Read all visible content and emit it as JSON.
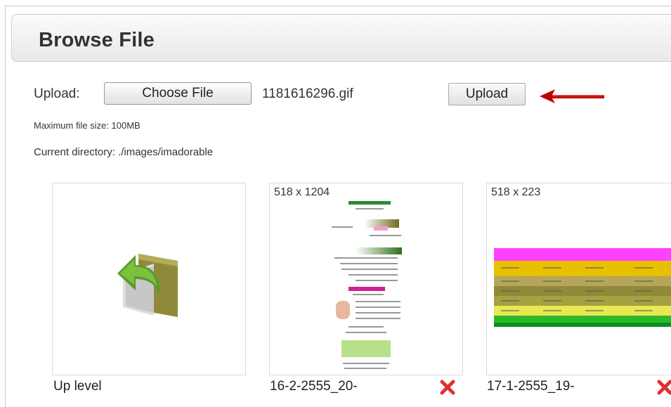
{
  "header": {
    "title": "Browse File"
  },
  "upload": {
    "label": "Upload:",
    "choose_label": "Choose File",
    "file_name": "1181616296.gif",
    "upload_label": "Upload",
    "max_size": "Maximum file size: 100MB"
  },
  "directory": {
    "text": "Current directory: ./images/imadorable"
  },
  "tiles": [
    {
      "caption": "Up level",
      "dimensions": "",
      "icon": "folder-up-icon"
    },
    {
      "caption": "16-2-2555_20-",
      "dimensions": "518 x 1204",
      "icon": "delete-icon"
    },
    {
      "caption": "17-1-2555_19-",
      "dimensions": "518 x 223",
      "icon": "delete-icon"
    }
  ],
  "colors": {
    "arrow": "#c00000",
    "delete": "#e03030",
    "folder_green": "#5a9a2a",
    "folder_olive": "#8f8a3a",
    "table_header": "#ff40ff"
  }
}
